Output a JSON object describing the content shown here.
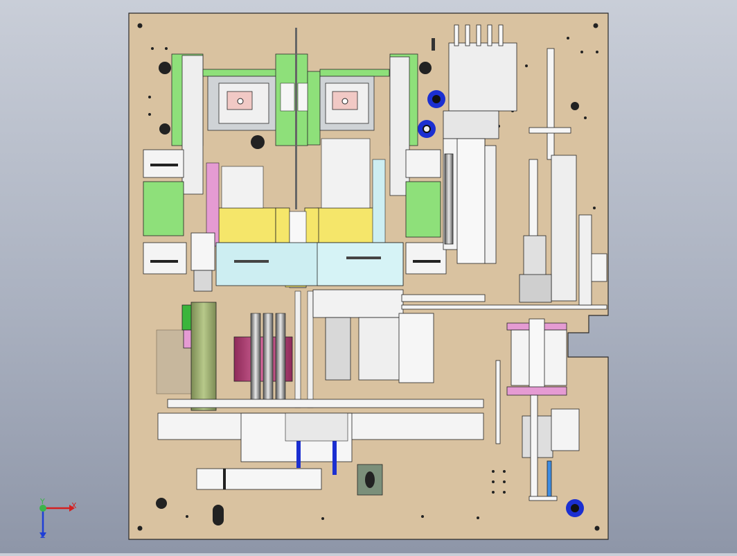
{
  "triad": {
    "x_label": "X",
    "y_label": "Y",
    "z_label": "Z"
  },
  "colors": {
    "background_top": "#c9ced8",
    "background_bottom": "#8e96a8",
    "base_plate": "#d9c2a0",
    "plate_outline": "#2a2a2a",
    "green_frame": "#8ee07a",
    "yellow_block": "#f5e66a",
    "cyan_plate": "#cdeef2",
    "magenta": "#c84f86",
    "pink_tape": "#e59bd3",
    "blue_part": "#1b2fd1",
    "olive_cylinder": "#9fb372",
    "grey_metal": "#c8c8c8",
    "white_part": "#f4f4f4"
  },
  "icons": {
    "triad": "xyz-axis-triad-icon"
  }
}
